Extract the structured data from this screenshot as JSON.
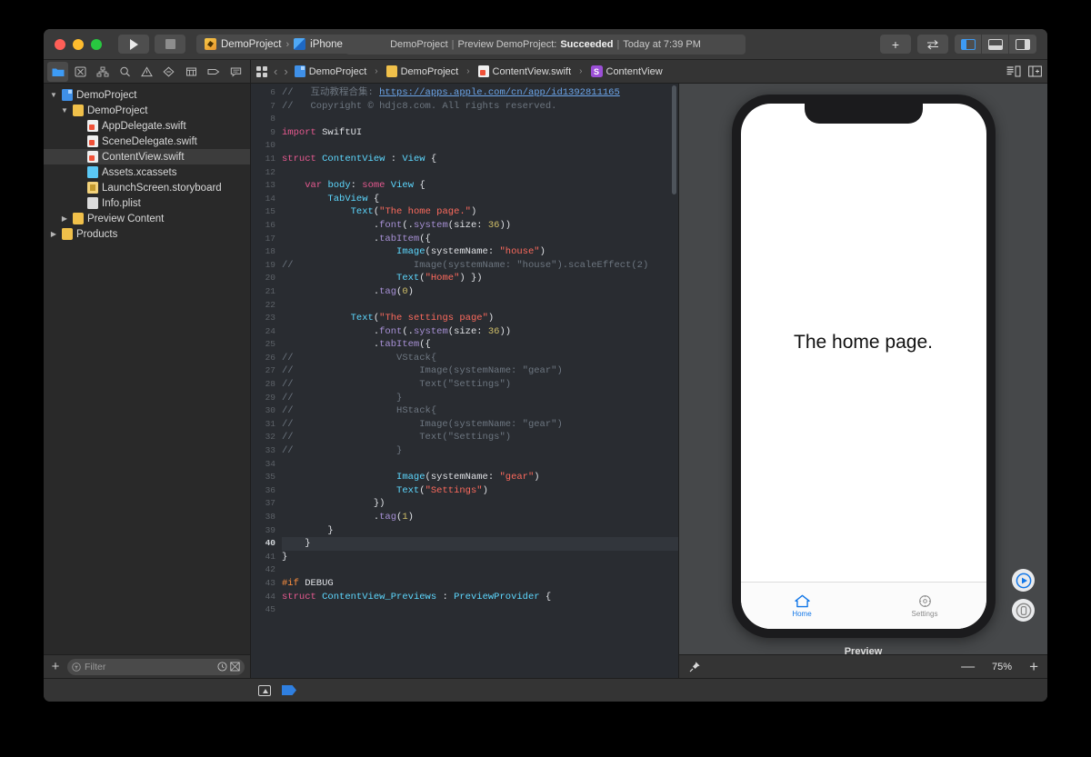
{
  "titlebar": {
    "run_icon": "play-icon",
    "stop_icon": "stop-icon",
    "scheme_name": "DemoProject",
    "scheme_separator": "›",
    "device_name": "iPhone Xʀ",
    "status": {
      "project": "DemoProject",
      "pipe": "|",
      "action": "Preview DemoProject:",
      "result": "Succeeded",
      "time": "Today at 7:39 PM"
    },
    "add_label": "+",
    "swap_icon": "swap-arrows-icon",
    "panel_toggles": [
      {
        "name": "navigator-toggle",
        "icon": "panel-left-icon",
        "active": true
      },
      {
        "name": "debug-toggle",
        "icon": "panel-bottom-icon",
        "active": false
      },
      {
        "name": "inspector-toggle",
        "icon": "panel-right-icon",
        "active": false
      }
    ]
  },
  "navigator": {
    "tabs": [
      {
        "name": "project-navigator",
        "icon": "folder-icon",
        "active": true
      },
      {
        "name": "source-control-navigator",
        "icon": "source-control-icon",
        "active": false
      },
      {
        "name": "symbol-navigator",
        "icon": "hierarchy-icon",
        "active": false
      },
      {
        "name": "find-navigator",
        "icon": "search-icon",
        "active": false
      },
      {
        "name": "issue-navigator",
        "icon": "warning-triangle-icon",
        "active": false
      },
      {
        "name": "test-navigator",
        "icon": "diamond-icon",
        "active": false
      },
      {
        "name": "debug-navigator",
        "icon": "gauge-icon",
        "active": false
      },
      {
        "name": "breakpoint-navigator",
        "icon": "tag-icon",
        "active": false
      },
      {
        "name": "report-navigator",
        "icon": "speech-bubble-icon",
        "active": false
      }
    ],
    "tree": [
      {
        "label": "DemoProject",
        "indent": 0,
        "twisty": "▼",
        "icon": "proj",
        "selected": false
      },
      {
        "label": "DemoProject",
        "indent": 1,
        "twisty": "▼",
        "icon": "folder",
        "selected": false
      },
      {
        "label": "AppDelegate.swift",
        "indent": 2,
        "twisty": "",
        "icon": "swift",
        "selected": false
      },
      {
        "label": "SceneDelegate.swift",
        "indent": 2,
        "twisty": "",
        "icon": "swift",
        "selected": false
      },
      {
        "label": "ContentView.swift",
        "indent": 2,
        "twisty": "",
        "icon": "swift",
        "selected": true
      },
      {
        "label": "Assets.xcassets",
        "indent": 2,
        "twisty": "",
        "icon": "folderblue",
        "selected": false
      },
      {
        "label": "LaunchScreen.storyboard",
        "indent": 2,
        "twisty": "",
        "icon": "story",
        "selected": false
      },
      {
        "label": "Info.plist",
        "indent": 2,
        "twisty": "",
        "icon": "plist",
        "selected": false
      },
      {
        "label": "Preview Content",
        "indent": 1,
        "twisty": "▶",
        "icon": "folder",
        "selected": false
      },
      {
        "label": "Products",
        "indent": 0,
        "twisty": "▶",
        "icon": "folder",
        "selected": false
      }
    ],
    "filter": {
      "add_label": "+",
      "placeholder": "Filter",
      "recent_icon": "clock-icon",
      "source_icon": "image-icon"
    }
  },
  "jumpbar": {
    "grid_icon": "related-items-icon",
    "back_arrow": "‹",
    "forward_arrow": "›",
    "crumbs": [
      {
        "label": "DemoProject",
        "icon": "project-icon"
      },
      {
        "label": "DemoProject",
        "icon": "folder-icon"
      },
      {
        "label": "ContentView.swift",
        "icon": "swift-file-icon"
      },
      {
        "label": "ContentView",
        "icon": "struct-symbol-icon",
        "badge": "S"
      }
    ],
    "separator": "›",
    "minimap_icon": "minimap-icon",
    "assistant_icon": "assistant-editor-icon"
  },
  "code": {
    "first_line": 6,
    "current_line": 40,
    "lines": [
      {
        "n": 6,
        "tokens": [
          {
            "t": "//   ",
            "c": "c-cmt"
          },
          {
            "t": "互动教程合集: ",
            "c": "c-cmt"
          },
          {
            "t": "https://apps.apple.com/cn/app/id1392811165",
            "c": "c-link"
          }
        ]
      },
      {
        "n": 7,
        "tokens": [
          {
            "t": "//   Copyright © hdjc8.com. All rights reserved.",
            "c": "c-cmt"
          }
        ]
      },
      {
        "n": 8,
        "tokens": []
      },
      {
        "n": 9,
        "tokens": [
          {
            "t": "import",
            "c": "c-kw"
          },
          {
            "t": " SwiftUI",
            "c": "c-plain"
          }
        ]
      },
      {
        "n": 10,
        "tokens": []
      },
      {
        "n": 11,
        "tokens": [
          {
            "t": "struct",
            "c": "c-kw"
          },
          {
            "t": " ",
            "c": "c-plain"
          },
          {
            "t": "ContentView",
            "c": "c-type"
          },
          {
            "t": " : ",
            "c": "c-plain"
          },
          {
            "t": "View",
            "c": "c-type"
          },
          {
            "t": " {",
            "c": "c-plain"
          }
        ]
      },
      {
        "n": 12,
        "tokens": []
      },
      {
        "n": 13,
        "tokens": [
          {
            "t": "    ",
            "c": "c-plain"
          },
          {
            "t": "var",
            "c": "c-kw"
          },
          {
            "t": " ",
            "c": "c-plain"
          },
          {
            "t": "body",
            "c": "c-type"
          },
          {
            "t": ": ",
            "c": "c-plain"
          },
          {
            "t": "some",
            "c": "c-kw"
          },
          {
            "t": " ",
            "c": "c-plain"
          },
          {
            "t": "View",
            "c": "c-type"
          },
          {
            "t": " {",
            "c": "c-plain"
          }
        ]
      },
      {
        "n": 14,
        "tokens": [
          {
            "t": "        ",
            "c": "c-plain"
          },
          {
            "t": "TabView",
            "c": "c-type"
          },
          {
            "t": " {",
            "c": "c-plain"
          }
        ]
      },
      {
        "n": 15,
        "tokens": [
          {
            "t": "            ",
            "c": "c-plain"
          },
          {
            "t": "Text",
            "c": "c-type"
          },
          {
            "t": "(",
            "c": "c-plain"
          },
          {
            "t": "\"The home page.\"",
            "c": "c-str"
          },
          {
            "t": ")",
            "c": "c-plain"
          }
        ]
      },
      {
        "n": 16,
        "tokens": [
          {
            "t": "                .",
            "c": "c-plain"
          },
          {
            "t": "font",
            "c": "c-fn"
          },
          {
            "t": "(.",
            "c": "c-plain"
          },
          {
            "t": "system",
            "c": "c-fn"
          },
          {
            "t": "(size: ",
            "c": "c-plain"
          },
          {
            "t": "36",
            "c": "c-num"
          },
          {
            "t": "))",
            "c": "c-plain"
          }
        ]
      },
      {
        "n": 17,
        "tokens": [
          {
            "t": "                .",
            "c": "c-plain"
          },
          {
            "t": "tabItem",
            "c": "c-fn"
          },
          {
            "t": "({",
            "c": "c-plain"
          }
        ]
      },
      {
        "n": 18,
        "tokens": [
          {
            "t": "                    ",
            "c": "c-plain"
          },
          {
            "t": "Image",
            "c": "c-type"
          },
          {
            "t": "(systemName: ",
            "c": "c-plain"
          },
          {
            "t": "\"house\"",
            "c": "c-str"
          },
          {
            "t": ")",
            "c": "c-plain"
          }
        ]
      },
      {
        "n": 19,
        "tokens": [
          {
            "t": "//                     Image(systemName: \"house\").scaleEffect(2)",
            "c": "c-cmt"
          }
        ]
      },
      {
        "n": 20,
        "tokens": [
          {
            "t": "                    ",
            "c": "c-plain"
          },
          {
            "t": "Text",
            "c": "c-type"
          },
          {
            "t": "(",
            "c": "c-plain"
          },
          {
            "t": "\"Home\"",
            "c": "c-str"
          },
          {
            "t": ") })",
            "c": "c-plain"
          }
        ]
      },
      {
        "n": 21,
        "tokens": [
          {
            "t": "                .",
            "c": "c-plain"
          },
          {
            "t": "tag",
            "c": "c-fn"
          },
          {
            "t": "(",
            "c": "c-plain"
          },
          {
            "t": "0",
            "c": "c-num"
          },
          {
            "t": ")",
            "c": "c-plain"
          }
        ]
      },
      {
        "n": 22,
        "tokens": []
      },
      {
        "n": 23,
        "tokens": [
          {
            "t": "            ",
            "c": "c-plain"
          },
          {
            "t": "Text",
            "c": "c-type"
          },
          {
            "t": "(",
            "c": "c-plain"
          },
          {
            "t": "\"The settings page\"",
            "c": "c-str"
          },
          {
            "t": ")",
            "c": "c-plain"
          }
        ]
      },
      {
        "n": 24,
        "tokens": [
          {
            "t": "                .",
            "c": "c-plain"
          },
          {
            "t": "font",
            "c": "c-fn"
          },
          {
            "t": "(.",
            "c": "c-plain"
          },
          {
            "t": "system",
            "c": "c-fn"
          },
          {
            "t": "(size: ",
            "c": "c-plain"
          },
          {
            "t": "36",
            "c": "c-num"
          },
          {
            "t": "))",
            "c": "c-plain"
          }
        ]
      },
      {
        "n": 25,
        "tokens": [
          {
            "t": "                .",
            "c": "c-plain"
          },
          {
            "t": "tabItem",
            "c": "c-fn"
          },
          {
            "t": "({",
            "c": "c-plain"
          }
        ]
      },
      {
        "n": 26,
        "tokens": [
          {
            "t": "//                  VStack{",
            "c": "c-cmt"
          }
        ]
      },
      {
        "n": 27,
        "tokens": [
          {
            "t": "//                      Image(systemName: \"gear\")",
            "c": "c-cmt"
          }
        ]
      },
      {
        "n": 28,
        "tokens": [
          {
            "t": "//                      Text(\"Settings\")",
            "c": "c-cmt"
          }
        ]
      },
      {
        "n": 29,
        "tokens": [
          {
            "t": "//                  }",
            "c": "c-cmt"
          }
        ]
      },
      {
        "n": 30,
        "tokens": [
          {
            "t": "//                  HStack{",
            "c": "c-cmt"
          }
        ]
      },
      {
        "n": 31,
        "tokens": [
          {
            "t": "//                      Image(systemName: \"gear\")",
            "c": "c-cmt"
          }
        ]
      },
      {
        "n": 32,
        "tokens": [
          {
            "t": "//                      Text(\"Settings\")",
            "c": "c-cmt"
          }
        ]
      },
      {
        "n": 33,
        "tokens": [
          {
            "t": "//                  }",
            "c": "c-cmt"
          }
        ]
      },
      {
        "n": 34,
        "tokens": []
      },
      {
        "n": 35,
        "tokens": [
          {
            "t": "                    ",
            "c": "c-plain"
          },
          {
            "t": "Image",
            "c": "c-type"
          },
          {
            "t": "(systemName: ",
            "c": "c-plain"
          },
          {
            "t": "\"gear\"",
            "c": "c-str"
          },
          {
            "t": ")",
            "c": "c-plain"
          }
        ]
      },
      {
        "n": 36,
        "tokens": [
          {
            "t": "                    ",
            "c": "c-plain"
          },
          {
            "t": "Text",
            "c": "c-type"
          },
          {
            "t": "(",
            "c": "c-plain"
          },
          {
            "t": "\"Settings\"",
            "c": "c-str"
          },
          {
            "t": ")",
            "c": "c-plain"
          }
        ]
      },
      {
        "n": 37,
        "tokens": [
          {
            "t": "                })",
            "c": "c-plain"
          }
        ]
      },
      {
        "n": 38,
        "tokens": [
          {
            "t": "                .",
            "c": "c-plain"
          },
          {
            "t": "tag",
            "c": "c-fn"
          },
          {
            "t": "(",
            "c": "c-plain"
          },
          {
            "t": "1",
            "c": "c-num"
          },
          {
            "t": ")",
            "c": "c-plain"
          }
        ]
      },
      {
        "n": 39,
        "tokens": [
          {
            "t": "        }",
            "c": "c-plain"
          }
        ]
      },
      {
        "n": 40,
        "tokens": [
          {
            "t": "    }",
            "c": "c-plain"
          }
        ]
      },
      {
        "n": 41,
        "tokens": [
          {
            "t": "}",
            "c": "c-plain"
          }
        ]
      },
      {
        "n": 42,
        "tokens": []
      },
      {
        "n": 43,
        "tokens": [
          {
            "t": "#if",
            "c": "c-prep"
          },
          {
            "t": " DEBUG",
            "c": "c-plain"
          }
        ]
      },
      {
        "n": 44,
        "tokens": [
          {
            "t": "struct",
            "c": "c-kw"
          },
          {
            "t": " ",
            "c": "c-plain"
          },
          {
            "t": "ContentView_Previews",
            "c": "c-type"
          },
          {
            "t": " : ",
            "c": "c-plain"
          },
          {
            "t": "PreviewProvider",
            "c": "c-type"
          },
          {
            "t": " {",
            "c": "c-plain"
          }
        ]
      },
      {
        "n": 45,
        "tokens": []
      }
    ]
  },
  "preview": {
    "device": "iPhone Xʀ",
    "screen_text": "The home page.",
    "tabs": [
      {
        "label": "Home",
        "icon": "house-icon",
        "selected": true
      },
      {
        "label": "Settings",
        "icon": "gear-icon",
        "selected": false
      }
    ],
    "caption": "Preview",
    "live_preview_icon": "play-circle-icon",
    "device_preview_icon": "device-circle-icon",
    "pin_icon": "pin-icon",
    "zoom_out": "—",
    "zoom_level": "75%",
    "zoom_in": "+"
  },
  "bottombar": {
    "filter_icon": "filter-bar-icon",
    "tag_icon": "blue-tag-icon"
  },
  "colors": {
    "accent": "#3d9bf5",
    "success": "#f2f2f2",
    "window_bg": "#2b2b2b",
    "code_bg": "#292c31",
    "canvas_bg": "#46484a",
    "tab_selected": "#1277e8"
  }
}
